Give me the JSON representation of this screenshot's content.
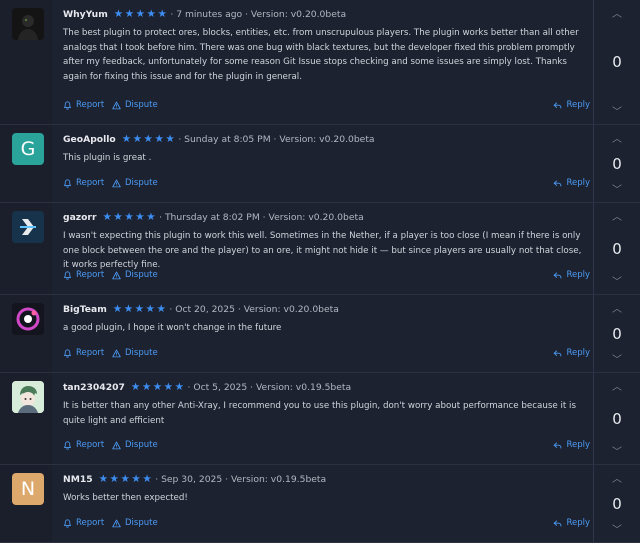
{
  "actions": {
    "report": "Report",
    "dispute": "Dispute",
    "reply": "Reply"
  },
  "reviews": [
    {
      "author": "WhyYum",
      "rating": 5,
      "time": "· 7 minutes ago · Version: v0.20.0beta",
      "text": "The best plugin to protect ores, blocks, entities, etc. from unscrupulous players. The plugin works better than all other analogs that I took before him. There was one bug with black textures, but the developer fixed this problem promptly after my feedback, unfortunately for some reason Git Issue stops checking and some issues are simply lost. Thanks again for fixing this issue and for the plugin in general.",
      "votes": "0",
      "avatar": {
        "kind": "image",
        "color": "#1a1a1a"
      }
    },
    {
      "author": "GeoApollo",
      "rating": 5,
      "time": "· Sunday at 8:05 PM · Version: v0.20.0beta",
      "text": "This plugin is great .",
      "votes": "0",
      "avatar": {
        "kind": "letter",
        "letter": "G",
        "color": "#2aa39b"
      }
    },
    {
      "author": "gazorr",
      "rating": 5,
      "time": "· Thursday at 8:02 PM · Version: v0.20.0beta",
      "text": "I wasn't expecting this plugin to work this well. Sometimes in the Nether, if a player is too close (I mean if there is only one block between the ore and the player) to an ore, it might not hide it — but since players are usually not that close, it works perfectly fine.",
      "votes": "0",
      "avatar": {
        "kind": "image",
        "color": "#1c3b55"
      }
    },
    {
      "author": "BigTeam",
      "rating": 5,
      "time": "· Oct 20, 2025 · Version: v0.20.0beta",
      "text": "a good plugin, I hope it won't change in the future",
      "votes": "0",
      "avatar": {
        "kind": "image",
        "color": "#151521"
      }
    },
    {
      "author": "tan2304207",
      "rating": 5,
      "time": "· Oct 5, 2025 · Version: v0.19.5beta",
      "text": "It is better than any other Anti-Xray, I recommend you to use this plugin, don't worry about performance because it is quite light and efficient",
      "votes": "0",
      "avatar": {
        "kind": "image",
        "color": "#cfe8d4"
      }
    },
    {
      "author": "NM15",
      "rating": 5,
      "time": "· Sep 30, 2025 · Version: v0.19.5beta",
      "text": "Works better then expected!",
      "votes": "0",
      "avatar": {
        "kind": "letter",
        "letter": "N",
        "color": "#dda86c"
      }
    }
  ]
}
